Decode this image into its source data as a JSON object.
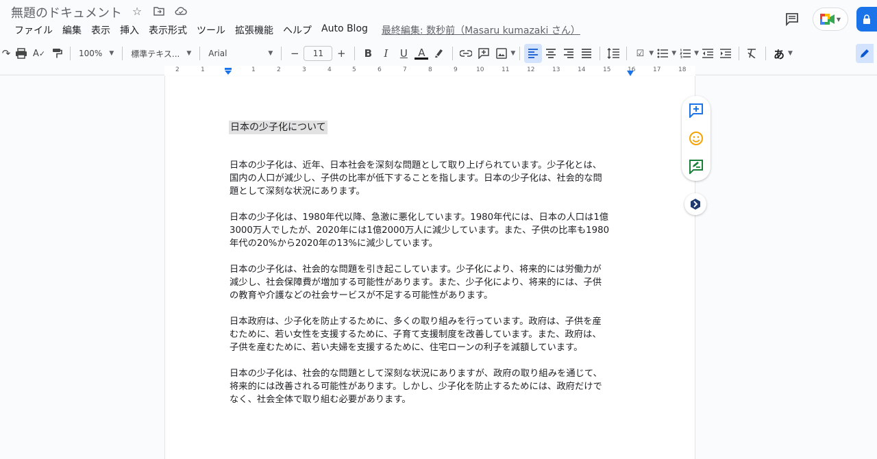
{
  "title_bar": {
    "doc_title": "無題のドキュメント",
    "last_edit": "最終編集: 数秒前（Masaru kumazaki さん）"
  },
  "menu": {
    "items": [
      "ファイル",
      "編集",
      "表示",
      "挿入",
      "表示形式",
      "ツール",
      "拡張機能",
      "ヘルプ",
      "Auto Blog"
    ]
  },
  "toolbar": {
    "zoom": "100%",
    "style": "標準テキス...",
    "font": "Arial",
    "font_size": "11",
    "minus": "−",
    "plus": "+",
    "bold": "B",
    "italic": "I",
    "underline": "U",
    "text_color": "A",
    "input_tool": "あ"
  },
  "ruler": {
    "labels": [
      "2",
      "1",
      "1",
      "2",
      "3",
      "4",
      "5",
      "6",
      "7",
      "8",
      "9",
      "10",
      "11",
      "12",
      "13",
      "14",
      "15",
      "16",
      "17",
      "18"
    ]
  },
  "document": {
    "heading": "日本の少子化について",
    "paragraphs": [
      {
        "lines": [
          "日本の少子化は、近年、日本社会を深刻な問題として取り上げられています。少子化とは、",
          "国内の人口が減少し、子供の比率が低下することを指します。日本の少子化は、社会的な問",
          "題として深刻な状況にあります。"
        ]
      },
      {
        "lines": [
          "日本の少子化は、1980年代以降、急激に悪化しています。1980年代には、日本の人口は1億",
          "3000万人でしたが、2020年には1億2000万人に減少しています。また、子供の比率も1980",
          "年代の20%から2020年の13%に減少しています。"
        ]
      },
      {
        "lines": [
          "日本の少子化は、社会的な問題を引き起こしています。少子化により、将来的には労働力が",
          "減少し、社会保障費が増加する可能性があります。また、少子化により、将来的には、子供",
          "の教育や介護などの社会サービスが不足する可能性があります。"
        ]
      },
      {
        "lines": [
          "日本政府は、少子化を防止するために、多くの取り組みを行っています。政府は、子供を産",
          "むために、若い女性を支援するために、子育て支援制度を改善しています。また、政府は、",
          "子供を産むために、若い夫婦を支援するために、住宅ローンの利子を減額しています。"
        ]
      },
      {
        "lines": [
          "日本の少子化は、社会的な問題として深刻な状況にありますが、政府の取り組みを通じて、",
          "将来的には改善される可能性があります。しかし、少子化を防止するためには、政府だけで",
          "なく、社会全体で取り組む必要があります。"
        ]
      }
    ]
  },
  "colors": {
    "accent": "#1a73e8",
    "emoji_yellow": "#f4a300",
    "suggest_green": "#188038"
  }
}
